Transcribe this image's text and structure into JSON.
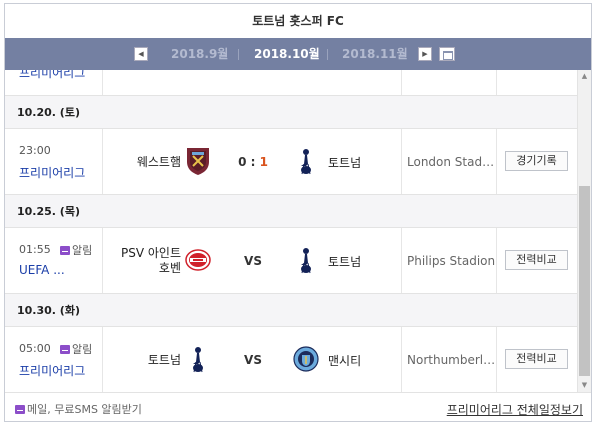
{
  "title": "토트넘 홋스퍼 FC",
  "month_nav": {
    "prev_month": "2018.9월",
    "current_month": "2018.10월",
    "next_month": "2018.11월"
  },
  "top_row": {
    "league": "프리미어리그"
  },
  "days": [
    {
      "date": "10.20. (토)",
      "match": {
        "time": "23:00",
        "alarm": "",
        "league": "프리미어리그",
        "home_team": "웨스트햄",
        "away_team": "토트넘",
        "home_score": "0",
        "score_sep": " : ",
        "away_score": "1",
        "venue": "London Stad…",
        "action": "경기기록",
        "home_crest": "west-ham-crest",
        "away_crest": "tottenham-crest"
      }
    },
    {
      "date": "10.25. (목)",
      "match": {
        "time": "01:55",
        "alarm": "알림",
        "league": "UEFA ...",
        "home_team": "PSV 아인트호벤",
        "away_team": "토트넘",
        "vs": "VS",
        "venue": "Philips Stadion",
        "action": "전력비교",
        "home_crest": "psv-crest",
        "away_crest": "tottenham-crest"
      }
    },
    {
      "date": "10.30. (화)",
      "match": {
        "time": "05:00",
        "alarm": "알림",
        "league": "프리미어리그",
        "home_team": "토트넘",
        "away_team": "맨시티",
        "vs": "VS",
        "venue": "Northumberl…",
        "action": "전력비교",
        "home_crest": "tottenham-crest",
        "away_crest": "man-city-crest"
      }
    }
  ],
  "footer": {
    "note": "메일, 무료SMS 알림받기",
    "link": "프리미어리그 전체일정보기"
  },
  "colors": {
    "month_bar": "#7480a2",
    "league_link": "#1b3ea8",
    "away_score": "#d9541e",
    "alarm_icon": "#8c4ec9"
  }
}
